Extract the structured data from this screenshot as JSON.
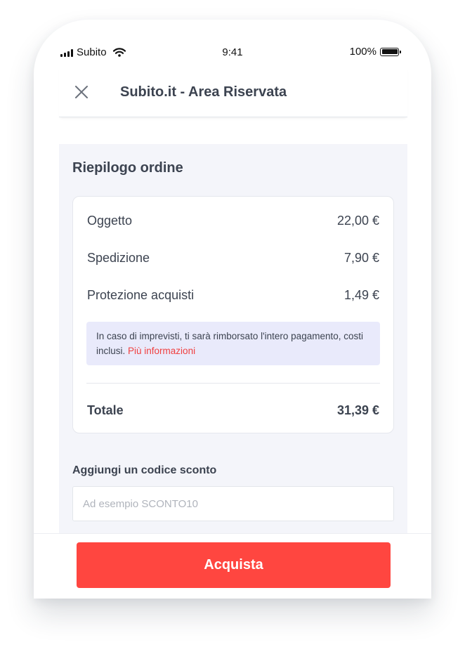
{
  "status_bar": {
    "carrier": "Subito",
    "time": "9:41",
    "battery": "100%"
  },
  "header": {
    "title": "Subito.it - Area Riservata",
    "close_icon": "close-icon"
  },
  "summary": {
    "title": "Riepilogo ordine",
    "rows": [
      {
        "label": "Oggetto",
        "value": "22,00 €"
      },
      {
        "label": "Spedizione",
        "value": "7,90 €"
      },
      {
        "label": "Protezione acquisti",
        "value": "1,49 €"
      }
    ],
    "info_text": "In caso di imprevisti, ti sarà rimborsato l'intero pagamento, costi inclusi.",
    "info_link": "Più informazioni",
    "total_label": "Totale",
    "total_value": "31,39 €"
  },
  "discount": {
    "label": "Aggiungi un codice sconto",
    "placeholder": "Ad esempio SCONTO10",
    "value": ""
  },
  "footer": {
    "buy_label": "Acquista"
  },
  "colors": {
    "accent": "#ff4640",
    "link": "#f03e3e",
    "text": "#3c4350",
    "info_bg": "#e9eafb",
    "panel_bg": "#f4f5fa"
  }
}
